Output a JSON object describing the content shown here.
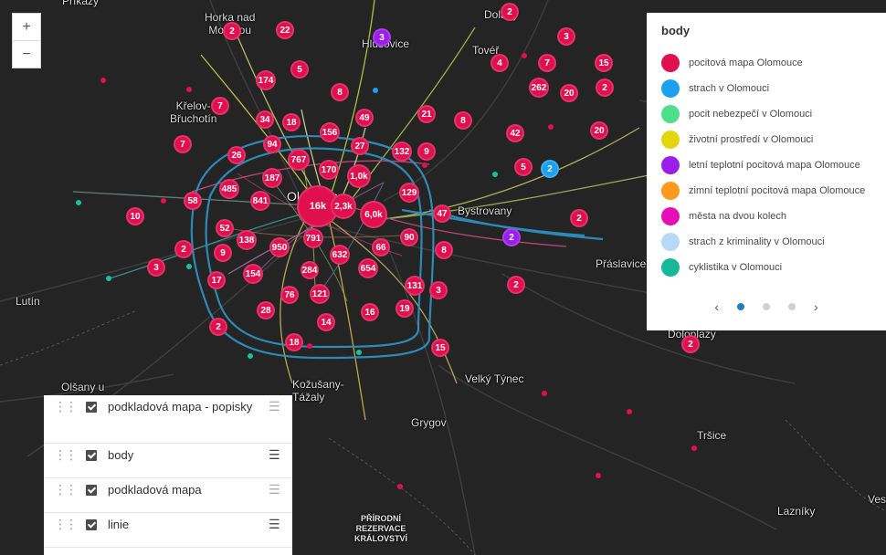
{
  "map": {
    "places": [
      {
        "id": "horka",
        "label": "Horka nad\nMoravou"
      },
      {
        "id": "hlusovice",
        "label": "Hlušovice"
      },
      {
        "id": "dolany",
        "label": "Dolany"
      },
      {
        "id": "tover",
        "label": "Tovéř"
      },
      {
        "id": "krelov",
        "label": "Křelov-\nBřuchotín"
      },
      {
        "id": "olomouc",
        "label": "Olomouc"
      },
      {
        "id": "bystrovany",
        "label": "Bystrovany"
      },
      {
        "id": "praslavice",
        "label": "Přáslavice"
      },
      {
        "id": "lutin",
        "label": "Lutín"
      },
      {
        "id": "olsany",
        "label": "Olšany u"
      },
      {
        "id": "krcmany",
        "label": "Kožušany-\nTážaly"
      },
      {
        "id": "velkytynec",
        "label": "Velký Týnec"
      },
      {
        "id": "grygov",
        "label": "Grygov"
      },
      {
        "id": "doloplazy",
        "label": "Doloplazy"
      },
      {
        "id": "trsice",
        "label": "Tršice"
      },
      {
        "id": "lazniky",
        "label": "Lazníky"
      },
      {
        "id": "ves",
        "label": "Ves"
      },
      {
        "id": "prikazy",
        "label": "Příkazy"
      },
      {
        "id": "reserve",
        "label": "PŘÍRODNÍ\nREZERVACE\nKRÁLOVSTVÍ"
      }
    ],
    "clusters": [
      "16k",
      "2,3k",
      "6,0k",
      "1,0k",
      "791",
      "767",
      "632",
      "654",
      "485",
      "841",
      "950",
      "284",
      "187",
      "170",
      "156",
      "174",
      "262",
      "154",
      "138",
      "132",
      "129",
      "131",
      "121",
      "94",
      "90",
      "76",
      "66",
      "58",
      "52",
      "49",
      "47",
      "42",
      "34",
      "28",
      "27",
      "26",
      "22",
      "21",
      "20",
      "20",
      "19",
      "18",
      "18",
      "17",
      "16",
      "15",
      "15",
      "14",
      "10",
      "9",
      "9",
      "8",
      "8",
      "8",
      "7",
      "7",
      "7",
      "5",
      "5",
      "4",
      "3",
      "3",
      "3",
      "3",
      "2",
      "2",
      "2",
      "2",
      "2",
      "2",
      "2",
      "2",
      "2",
      "2"
    ],
    "zoom": {
      "in": "+",
      "out": "−"
    }
  },
  "legend": {
    "title": "body",
    "items": [
      {
        "label": "pocitová mapa Olomouce",
        "color": "#e0104f"
      },
      {
        "label": "strach v Olomouci",
        "color": "#1ea0f0"
      },
      {
        "label": "pocit nebezpečí v Olomouci",
        "color": "#4fde8c"
      },
      {
        "label": "životní prostředí v Olomouci",
        "color": "#e3d60f"
      },
      {
        "label": "letní teplotní pocitová mapa Olomouce",
        "color": "#9b1fe8"
      },
      {
        "label": "zimní teplotní pocitová mapa Olomouce",
        "color": "#ff9a1f"
      },
      {
        "label": "města na dvou kolech",
        "color": "#e60fb6"
      },
      {
        "label": "strach z kriminality v Olomouci",
        "color": "#b8d8f8"
      },
      {
        "label": "cyklistika v Olomouci",
        "color": "#17b897"
      }
    ],
    "pager": {
      "prev": "‹",
      "next": "›",
      "pages": 3,
      "current": 1
    }
  },
  "layers": [
    {
      "name": "podkladová mapa - popisky",
      "checked": true
    },
    {
      "name": "body",
      "checked": true
    },
    {
      "name": "podkladová mapa",
      "checked": true
    },
    {
      "name": "linie",
      "checked": true
    }
  ]
}
